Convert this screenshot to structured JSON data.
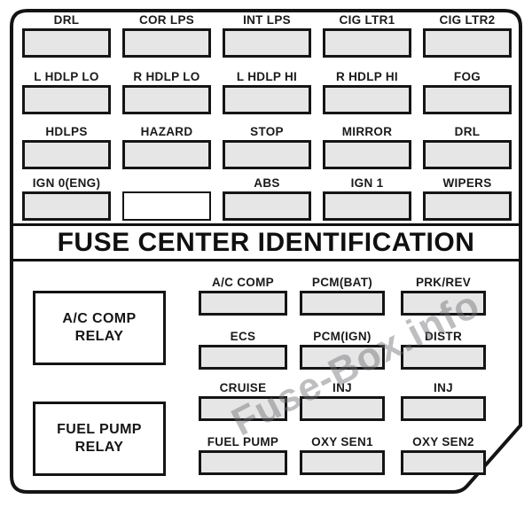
{
  "diagram": {
    "title": "FUSE CENTER IDENTIFICATION",
    "watermark": "Fuse-Box.info",
    "colors": {
      "outline": "#141414",
      "fuse_fill": "#e6e6e6",
      "empty_fuse_fill": "#ffffff",
      "background": "#ffffff",
      "watermark": "#6e6e76"
    }
  },
  "upper_section": {
    "rows": [
      {
        "fuses": [
          {
            "label": "DRL",
            "empty": false
          },
          {
            "label": "COR LPS",
            "empty": false
          },
          {
            "label": "INT LPS",
            "empty": false
          },
          {
            "label": "CIG LTR1",
            "empty": false
          },
          {
            "label": "CIG LTR2",
            "empty": false
          }
        ]
      },
      {
        "fuses": [
          {
            "label": "L HDLP LO",
            "empty": false
          },
          {
            "label": "R HDLP LO",
            "empty": false
          },
          {
            "label": "L HDLP HI",
            "empty": false
          },
          {
            "label": "R HDLP HI",
            "empty": false
          },
          {
            "label": "FOG",
            "empty": false
          }
        ]
      },
      {
        "fuses": [
          {
            "label": "HDLPS",
            "empty": false
          },
          {
            "label": "HAZARD",
            "empty": false
          },
          {
            "label": "STOP",
            "empty": false
          },
          {
            "label": "MIRROR",
            "empty": false
          },
          {
            "label": "DRL",
            "empty": false
          }
        ]
      },
      {
        "fuses": [
          {
            "label": "IGN 0(ENG)",
            "empty": false
          },
          {
            "label": "",
            "empty": true
          },
          {
            "label": "ABS",
            "empty": false
          },
          {
            "label": "IGN 1",
            "empty": false
          },
          {
            "label": "WIPERS",
            "empty": false
          }
        ]
      }
    ]
  },
  "lower_section": {
    "relays": [
      {
        "line1": "A/C COMP",
        "line2": "RELAY"
      },
      {
        "line1": "FUEL PUMP",
        "line2": "RELAY"
      }
    ],
    "rows": [
      {
        "fuses": [
          {
            "label": "A/C COMP",
            "empty": false
          },
          {
            "label": "PCM(BAT)",
            "empty": false
          },
          {
            "label": "PRK/REV",
            "empty": false
          }
        ]
      },
      {
        "fuses": [
          {
            "label": "ECS",
            "empty": false
          },
          {
            "label": "PCM(IGN)",
            "empty": false
          },
          {
            "label": "DISTR",
            "empty": false
          }
        ]
      },
      {
        "fuses": [
          {
            "label": "CRUISE",
            "empty": false
          },
          {
            "label": "INJ",
            "empty": false
          },
          {
            "label": "INJ",
            "empty": false
          }
        ]
      },
      {
        "fuses": [
          {
            "label": "FUEL PUMP",
            "empty": false
          },
          {
            "label": "OXY SEN1",
            "empty": false
          },
          {
            "label": "OXY SEN2",
            "empty": false
          }
        ]
      }
    ]
  }
}
